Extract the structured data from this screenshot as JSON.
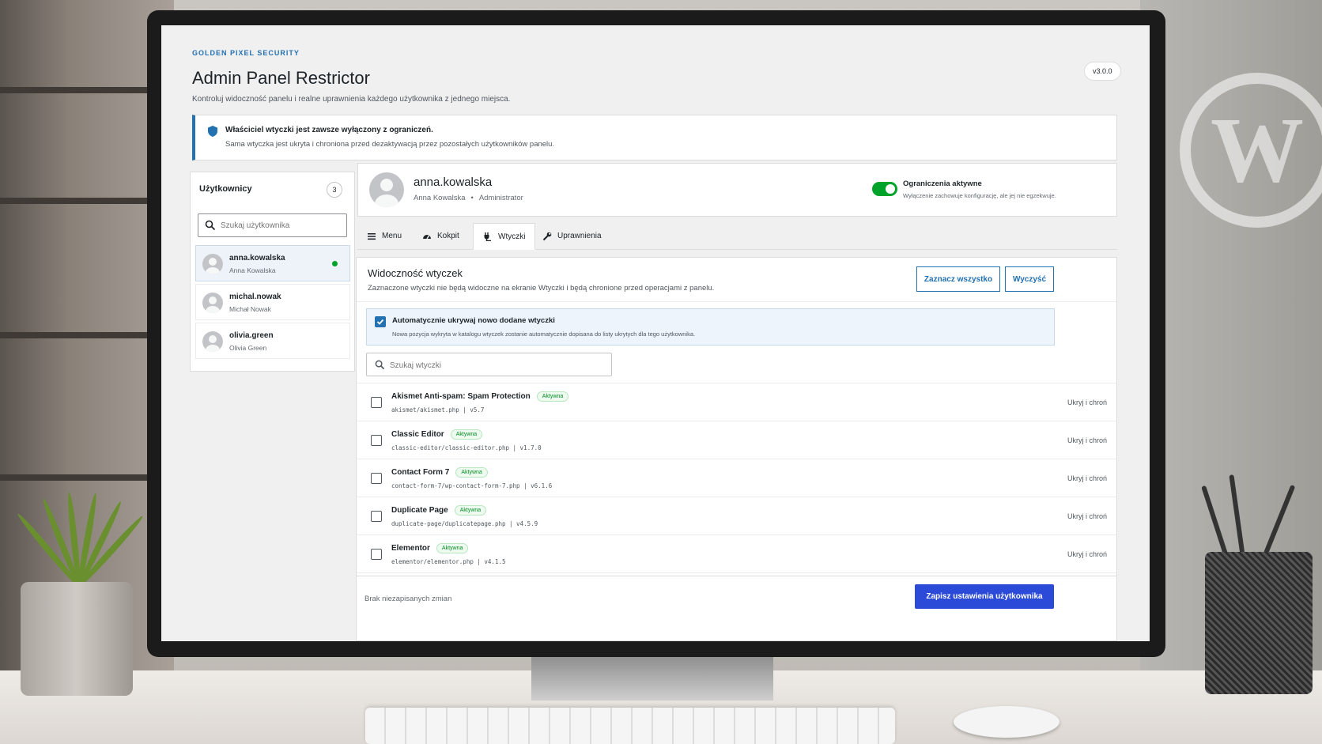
{
  "app": {
    "brand": "GOLDEN PIXEL SECURITY",
    "title": "Admin Panel Restrictor",
    "description": "Kontroluj widoczność panelu i realne uprawnienia każdego użytkownika z jednego miejsca.",
    "version": "v3.0.0"
  },
  "notice": {
    "icon": "shield-icon",
    "title": "Właściciel wtyczki jest zawsze wyłączony z ograniczeń.",
    "text": "Sama wtyczka jest ukryta i chroniona przed dezaktywacją przez pozostałych użytkowników panelu."
  },
  "sidebar": {
    "title": "Użytkownicy",
    "count": "3",
    "search_placeholder": "Szukaj użytkownika",
    "users": [
      {
        "login": "anna.kowalska",
        "name": "Anna Kowalska",
        "active": true
      },
      {
        "login": "michal.nowak",
        "name": "Michał Nowak",
        "active": false
      },
      {
        "login": "olivia.green",
        "name": "Olivia Green",
        "active": false
      }
    ]
  },
  "user_header": {
    "login": "anna.kowalska",
    "name": "Anna Kowalska",
    "separator": "•",
    "role": "Administrator",
    "toggle_label": "Ograniczenia aktywne",
    "toggle_desc": "Wyłączenie zachowuje konfigurację, ale jej nie egzekwuje.",
    "toggle_on": true
  },
  "tabs": [
    {
      "label": "Menu",
      "icon": "menu-icon"
    },
    {
      "label": "Kokpit",
      "icon": "dashboard-icon"
    },
    {
      "label": "Wtyczki",
      "icon": "plugin-icon",
      "active": true
    },
    {
      "label": "Uprawnienia",
      "icon": "wrench-icon"
    }
  ],
  "plugins_card": {
    "title": "Widoczność wtyczek",
    "description": "Zaznaczone wtyczki nie będą widoczne na ekranie Wtyczki i będą chronione przed operacjami z panelu.",
    "select_all": "Zaznacz wszystko",
    "clear": "Wyczyść",
    "auto_hide_title": "Automatycznie ukrywaj nowo dodane wtyczki",
    "auto_hide_desc": "Nowa pozycja wykryta w katalogu wtyczek zostanie automatycznie dopisana do listy ukrytych dla tego użytkownika.",
    "auto_hide_checked": true,
    "search_placeholder": "Szukaj wtyczki",
    "items": [
      {
        "name": "Akismet Anti-spam: Spam Protection",
        "badge": "Aktywna",
        "path": "akismet/akismet.php | v5.7",
        "action": "Ukryj i chroń"
      },
      {
        "name": "Classic Editor",
        "badge": "Aktywna",
        "path": "classic-editor/classic-editor.php | v1.7.0",
        "action": "Ukryj i chroń"
      },
      {
        "name": "Contact Form 7",
        "badge": "Aktywna",
        "path": "contact-form-7/wp-contact-form-7.php | v6.1.6",
        "action": "Ukryj i chroń"
      },
      {
        "name": "Duplicate Page",
        "badge": "Aktywna",
        "path": "duplicate-page/duplicatepage.php | v4.5.9",
        "action": "Ukryj i chroń"
      },
      {
        "name": "Elementor",
        "badge": "Aktywna",
        "path": "elementor/elementor.php | v4.1.5",
        "action": "Ukryj i chroń"
      }
    ]
  },
  "footer": {
    "status": "Brak niezapisanych zmian",
    "save_label": "Zapisz ustawienia użytkownika"
  },
  "colors": {
    "accent": "#2271b1",
    "primary_button": "#2b4ad8",
    "toggle_on": "#00a32a",
    "badge_text": "#008a20"
  }
}
